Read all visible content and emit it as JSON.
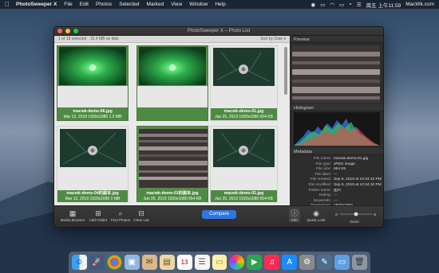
{
  "menubar": {
    "apple": "",
    "app": "PhotoSweeper X",
    "items": [
      "File",
      "Edit",
      "Photos",
      "Selected",
      "Marked",
      "View",
      "Window",
      "Help"
    ],
    "clock": "周五 上午11:59",
    "site": "MacWk.com"
  },
  "window": {
    "title": "PhotoSweeper X – Photo List",
    "status": "1 of 18 selected · 15.4 MB on disk",
    "sort": "Sort by Date ▾"
  },
  "photos": [
    {
      "name": "macwk-demo-06.jpg",
      "info": "Mar 12, 2019  1920x1080  1.2 MB"
    },
    {
      "name": "",
      "info": ""
    },
    {
      "name": "macwk-demo-01.jpg",
      "info": "Jun 25, 2019  1920x1080  654 KB"
    },
    {
      "name": "macwk-demo-04的副本.jpg",
      "info": "Mar 12, 2019  1920x1080  2 MB"
    },
    {
      "name": "macwk-demo-01的副本.jpg",
      "info": "Jun 25, 2019  1920x1080  654 KB"
    },
    {
      "name": "macwk-demo-01.jpg",
      "info": "Jun 25, 2019  1920x1080  654 KB"
    }
  ],
  "path": [
    "macwk.com",
    "Documents",
    "iCollections",
    "工作目录",
    "MacWk.com",
    "图片",
    "macwk-demo-01.jpg"
  ],
  "right": {
    "preview_label": "Preview",
    "histogram_label": "Histogram",
    "metadata_label": "Metadata",
    "metadata": [
      {
        "k": "File name:",
        "v": "macwk-demo-01.jpg"
      },
      {
        "k": "File type:",
        "v": "JPEG image"
      },
      {
        "k": "File size:",
        "v": "654 Kb"
      },
      {
        "k": "File label:",
        "v": "---"
      },
      {
        "k": "File created:",
        "v": "Sep 6, 2019 at 10:34:10 PM"
      },
      {
        "k": "File modified:",
        "v": "Sep 6, 2019 at 10:34:10 PM"
      },
      {
        "k": "Folder name:",
        "v": "图片"
      },
      {
        "k": "Rating:",
        "v": "---"
      },
      {
        "k": "Keywords:",
        "v": "---"
      },
      {
        "k": "Dimensions:",
        "v": "1920x1080"
      },
      {
        "k": "DPI:",
        "v": "300.0x300.0"
      },
      {
        "k": "Orientation:",
        "v": "1 (Normal)"
      }
    ]
  },
  "bottombar": {
    "media_browser": "Media Browser",
    "add_folder": "Add Folder",
    "find_photos": "Find Photos",
    "clear_list": "Clear List",
    "compare": "Compare",
    "info": "Info",
    "quick_look": "Quick Look",
    "zoom": "Zoom",
    "zoom_value": 0.5,
    "zoom_label": "Zoom"
  },
  "dock_icons": [
    "finder-icon",
    "launchpad-icon",
    "chrome-icon",
    "preview-icon",
    "mail-icon",
    "notes-icon",
    "calendar-icon",
    "reminders-icon",
    "stickies-icon",
    "photos-icon",
    "facetime-icon",
    "music-icon",
    "appstore-icon",
    "preferences-icon",
    "photosweeper-icon",
    "folder-icon",
    "trash-icon"
  ],
  "calendar_day": "13",
  "colors": {
    "accent": "#2f76e0",
    "selection": "#4f8a43"
  }
}
